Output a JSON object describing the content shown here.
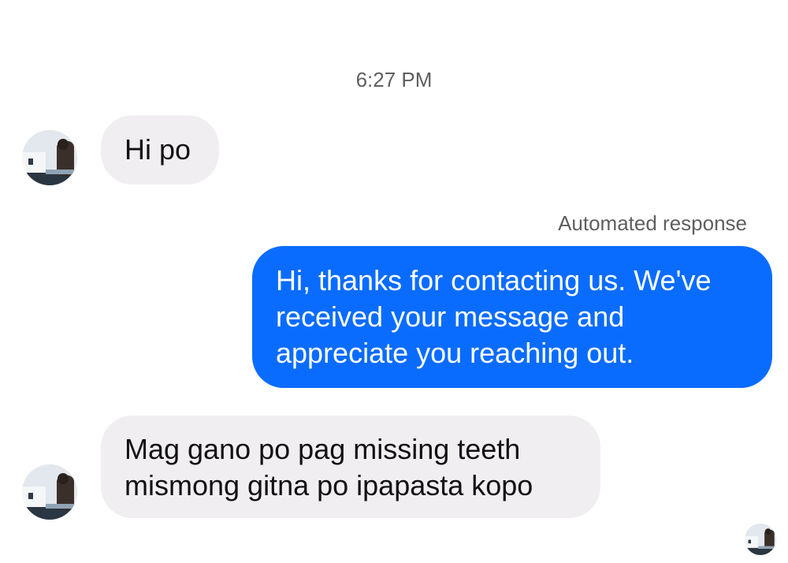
{
  "conversation": {
    "timestamp": "6:27 PM",
    "messages": [
      {
        "direction": "incoming",
        "text": "Hi po"
      },
      {
        "direction": "outgoing",
        "label": "Automated response",
        "text": "Hi, thanks for contacting us. We've received your message and appreciate you reaching out."
      },
      {
        "direction": "incoming",
        "text": "Mag gano po pag missing teeth mismong gitna po ipapasta kopo"
      }
    ]
  },
  "colors": {
    "incoming_bubble": "#f1eef2",
    "outgoing_bubble": "#0a6cff",
    "meta_text": "#5f5f5f"
  },
  "icons": {
    "sender_avatar": "contact-avatar-icon",
    "read_receipt": "seen-avatar-icon"
  }
}
